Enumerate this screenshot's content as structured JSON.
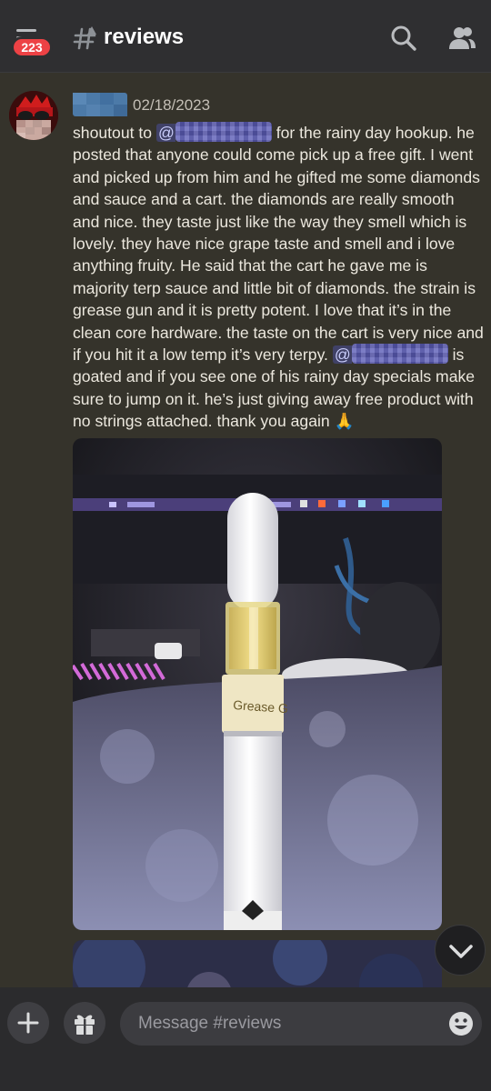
{
  "header": {
    "menu_icon": "hamburger-menu-icon",
    "unread_badge": "223",
    "channel_hash_icon": "text-channel-hash-icon",
    "channel_name": "reviews",
    "search_icon": "search-icon",
    "members_icon": "members-icon"
  },
  "message": {
    "timestamp": "02/18/2023",
    "text_1": "shoutout to ",
    "mention_prefix": "@",
    "text_2": " for the rainy day hookup. he posted that anyone could come pick up a free gift. I went and picked up from him and he gifted me some diamonds and sauce and a cart. the diamonds are really smooth and nice. they taste just like the way they smell which is lovely. they have nice grape taste and smell and i love anything fruity. He said that the cart he gave me is majority terp sauce and little bit of diamonds. the strain is grease gun and it is pretty potent. I love that it’s in the clean core hardware. the taste on the cart is very nice and if you hit it a low temp it’s very terpy. ",
    "text_3": " is goated and if you see one of his rainy day specials make sure to jump on it. he’s just giving away free product with no strings attached. thank you again ",
    "emoji": "🙏",
    "photo_label": "Grease G"
  },
  "composer": {
    "add_icon": "plus-icon",
    "gift_icon": "gift-icon",
    "placeholder": "Message #reviews",
    "emoji_icon": "emoji-icon"
  },
  "jump_icon": "chevron-down-icon",
  "colors": {
    "badge": "#ed4245",
    "mention": "#5a5bb5",
    "background": "#35332b",
    "header": "#2f2f31"
  }
}
